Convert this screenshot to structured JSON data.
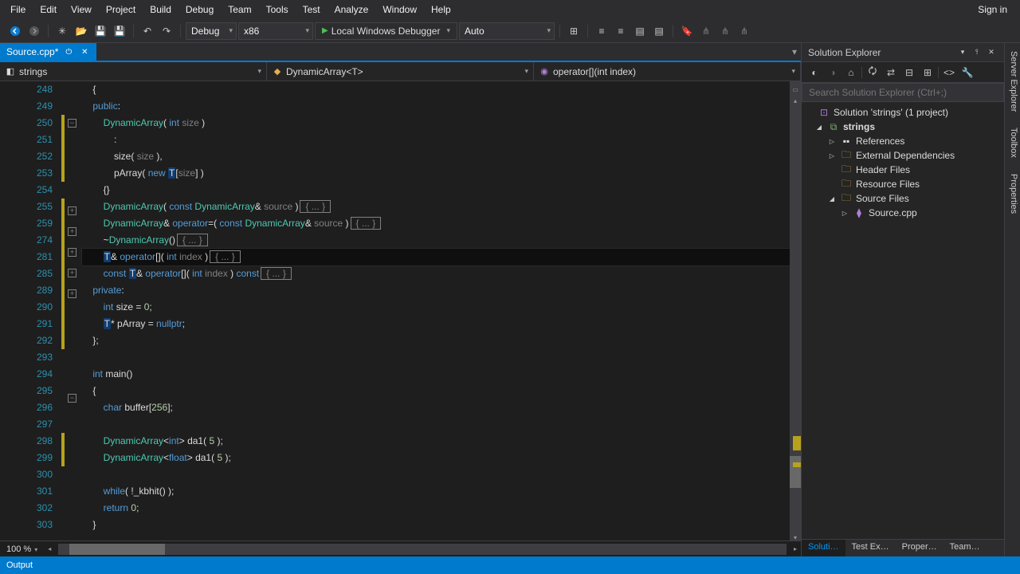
{
  "menubar": {
    "items": [
      "File",
      "Edit",
      "View",
      "Project",
      "Build",
      "Debug",
      "Team",
      "Tools",
      "Test",
      "Analyze",
      "Window",
      "Help"
    ],
    "signin": "Sign in"
  },
  "toolbar": {
    "config": "Debug",
    "platform": "x86",
    "debugger": "Local Windows Debugger",
    "diag": "Auto"
  },
  "tabs": {
    "active": "Source.cpp*"
  },
  "nav": {
    "scope": "strings",
    "class": "DynamicArray<T>",
    "member": "operator[](int index)"
  },
  "solution_explorer": {
    "title": "Solution Explorer",
    "search_placeholder": "Search Solution Explorer (Ctrl+;)",
    "solution_label": "Solution 'strings' (1 project)",
    "project": "strings",
    "folders": {
      "references": "References",
      "external": "External Dependencies",
      "headers": "Header Files",
      "resources": "Resource Files",
      "sources": "Source Files"
    },
    "source_file": "Source.cpp"
  },
  "side_tabs": [
    "Server Explorer",
    "Toolbox",
    "Properties"
  ],
  "bottom_tabs": [
    "Soluti…",
    "Test Ex…",
    "Proper…",
    "Team…"
  ],
  "output_label": "Output",
  "zoom": "100 %",
  "code": {
    "lines": [
      {
        "n": 248,
        "c": "",
        "y": 0,
        "f": "",
        "txt": "    {"
      },
      {
        "n": 249,
        "c": "",
        "y": 0,
        "f": "",
        "txt": "    <span class='kw'>public</span>:"
      },
      {
        "n": 250,
        "c": "",
        "y": 1,
        "f": "-",
        "txt": "        <span class='typ'>DynamicArray</span>( <span class='kw'>int</span> <span class='prm'>size</span> )"
      },
      {
        "n": 251,
        "c": "",
        "y": 1,
        "f": "",
        "txt": "            :"
      },
      {
        "n": 252,
        "c": "",
        "y": 1,
        "f": "",
        "txt": "            size( <span class='prm'>size</span> ),"
      },
      {
        "n": 253,
        "c": "",
        "y": 1,
        "f": "",
        "txt": "            pArray( <span class='kw'>new</span> <span class='hlT'>T</span>[<span class='prm'>size</span>] )"
      },
      {
        "n": 254,
        "c": "",
        "y": 0,
        "f": "",
        "txt": "        {}"
      },
      {
        "n": 255,
        "c": "",
        "y": 1,
        "f": "+",
        "txt": "        <span class='typ'>DynamicArray</span>( <span class='kw'>const</span> <span class='typ'>DynamicArray</span>&amp; <span class='prm'>source</span> )<span class='foldbox-inline'>{ ... }</span>"
      },
      {
        "n": 259,
        "c": "",
        "y": 1,
        "f": "+",
        "txt": "        <span class='typ'>DynamicArray</span>&amp; <span class='kw'>operator</span>=( <span class='kw'>const</span> <span class='typ'>DynamicArray</span>&amp; <span class='prm'>source</span> )<span class='foldbox-inline'>{ ... }</span>"
      },
      {
        "n": 274,
        "c": "",
        "y": 1,
        "f": "+",
        "txt": "        ~<span class='typ'>DynamicArray</span>()<span class='foldbox-inline'>{ ... }</span>"
      },
      {
        "n": 281,
        "c": "cur",
        "y": 1,
        "f": "+",
        "txt": "        <span class='hlT'>T</span>&amp; <span class='kw'>operator</span>[]( <span class='kw'>int</span> <span class='prm'>index</span> )<span class='foldbox-inline'>{ ... }</span>"
      },
      {
        "n": 285,
        "c": "",
        "y": 1,
        "f": "+",
        "txt": "        <span class='kw'>const</span> <span class='hlT'>T</span>&amp; <span class='kw'>operator</span>[]( <span class='kw'>int</span> <span class='prm'>index</span> ) <span class='kw'>const</span><span class='foldbox-inline'>{ ... }</span>"
      },
      {
        "n": 289,
        "c": "",
        "y": 1,
        "f": "",
        "txt": "    <span class='kw'>private</span>:"
      },
      {
        "n": 290,
        "c": "",
        "y": 1,
        "f": "",
        "txt": "        <span class='kw'>int</span> size = <span class='num'>0</span>;"
      },
      {
        "n": 291,
        "c": "",
        "y": 1,
        "f": "",
        "txt": "        <span class='hlT'>T</span>* pArray = <span class='kw'>nullptr</span>;"
      },
      {
        "n": 292,
        "c": "",
        "y": 1,
        "f": "",
        "txt": "    };"
      },
      {
        "n": 293,
        "c": "",
        "y": 0,
        "f": "",
        "txt": ""
      },
      {
        "n": 294,
        "c": "",
        "y": 0,
        "f": "-",
        "txt": "    <span class='kw'>int</span> main()"
      },
      {
        "n": 295,
        "c": "",
        "y": 0,
        "f": "",
        "txt": "    {"
      },
      {
        "n": 296,
        "c": "",
        "y": 0,
        "f": "",
        "txt": "        <span class='kw'>char</span> buffer[<span class='num'>256</span>];"
      },
      {
        "n": 297,
        "c": "",
        "y": 0,
        "f": "",
        "txt": ""
      },
      {
        "n": 298,
        "c": "",
        "y": 1,
        "f": "",
        "txt": "        <span class='typ'>DynamicArray</span>&lt;<span class='kw'>int</span>&gt; da1( <span class='num'>5</span> );"
      },
      {
        "n": 299,
        "c": "",
        "y": 1,
        "f": "",
        "txt": "        <span class='typ'>DynamicArray</span>&lt;<span class='kw'>float</span>&gt; da1( <span class='num'>5</span> );"
      },
      {
        "n": 300,
        "c": "",
        "y": 0,
        "f": "",
        "txt": ""
      },
      {
        "n": 301,
        "c": "",
        "y": 0,
        "f": "",
        "txt": "        <span class='kw'>while</span>( !_kbhit() );"
      },
      {
        "n": 302,
        "c": "",
        "y": 0,
        "f": "",
        "txt": "        <span class='kw'>return</span> <span class='num'>0</span>;"
      },
      {
        "n": 303,
        "c": "",
        "y": 0,
        "f": "",
        "txt": "    }"
      }
    ]
  }
}
